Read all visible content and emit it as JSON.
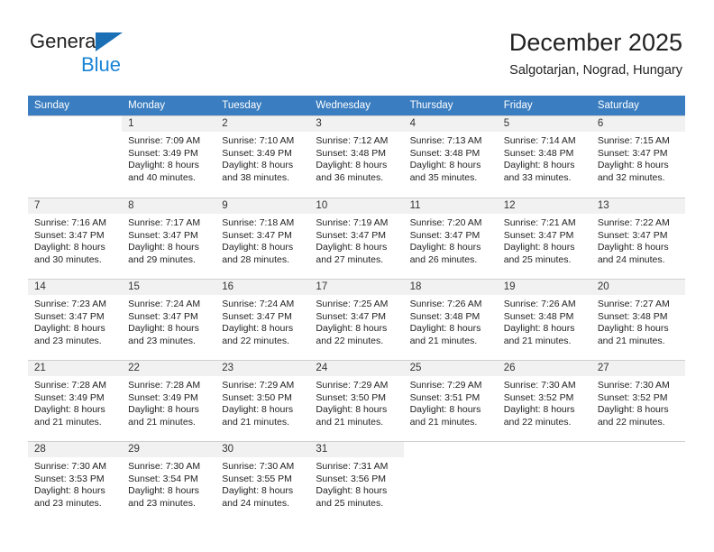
{
  "brand": {
    "name_part1": "General",
    "name_part2": "Blue",
    "triangle_icon": "triangle-icon",
    "colors": {
      "general": "#222222",
      "blue": "#1a84d6",
      "triangle": "#1a6fb5"
    }
  },
  "header": {
    "title": "December 2025",
    "subtitle": "Salgotarjan, Nograd, Hungary"
  },
  "theme": {
    "header_row_bg": "#3a7dc0",
    "header_row_text": "#ffffff",
    "day_number_bg": "#f1f1f1",
    "grid_line": "#cfcfcf"
  },
  "weekdays": [
    "Sunday",
    "Monday",
    "Tuesday",
    "Wednesday",
    "Thursday",
    "Friday",
    "Saturday"
  ],
  "weeks": [
    [
      {
        "day": "",
        "lines": []
      },
      {
        "day": "1",
        "lines": [
          "Sunrise: 7:09 AM",
          "Sunset: 3:49 PM",
          "Daylight: 8 hours",
          "and 40 minutes."
        ]
      },
      {
        "day": "2",
        "lines": [
          "Sunrise: 7:10 AM",
          "Sunset: 3:49 PM",
          "Daylight: 8 hours",
          "and 38 minutes."
        ]
      },
      {
        "day": "3",
        "lines": [
          "Sunrise: 7:12 AM",
          "Sunset: 3:48 PM",
          "Daylight: 8 hours",
          "and 36 minutes."
        ]
      },
      {
        "day": "4",
        "lines": [
          "Sunrise: 7:13 AM",
          "Sunset: 3:48 PM",
          "Daylight: 8 hours",
          "and 35 minutes."
        ]
      },
      {
        "day": "5",
        "lines": [
          "Sunrise: 7:14 AM",
          "Sunset: 3:48 PM",
          "Daylight: 8 hours",
          "and 33 minutes."
        ]
      },
      {
        "day": "6",
        "lines": [
          "Sunrise: 7:15 AM",
          "Sunset: 3:47 PM",
          "Daylight: 8 hours",
          "and 32 minutes."
        ]
      }
    ],
    [
      {
        "day": "7",
        "lines": [
          "Sunrise: 7:16 AM",
          "Sunset: 3:47 PM",
          "Daylight: 8 hours",
          "and 30 minutes."
        ]
      },
      {
        "day": "8",
        "lines": [
          "Sunrise: 7:17 AM",
          "Sunset: 3:47 PM",
          "Daylight: 8 hours",
          "and 29 minutes."
        ]
      },
      {
        "day": "9",
        "lines": [
          "Sunrise: 7:18 AM",
          "Sunset: 3:47 PM",
          "Daylight: 8 hours",
          "and 28 minutes."
        ]
      },
      {
        "day": "10",
        "lines": [
          "Sunrise: 7:19 AM",
          "Sunset: 3:47 PM",
          "Daylight: 8 hours",
          "and 27 minutes."
        ]
      },
      {
        "day": "11",
        "lines": [
          "Sunrise: 7:20 AM",
          "Sunset: 3:47 PM",
          "Daylight: 8 hours",
          "and 26 minutes."
        ]
      },
      {
        "day": "12",
        "lines": [
          "Sunrise: 7:21 AM",
          "Sunset: 3:47 PM",
          "Daylight: 8 hours",
          "and 25 minutes."
        ]
      },
      {
        "day": "13",
        "lines": [
          "Sunrise: 7:22 AM",
          "Sunset: 3:47 PM",
          "Daylight: 8 hours",
          "and 24 minutes."
        ]
      }
    ],
    [
      {
        "day": "14",
        "lines": [
          "Sunrise: 7:23 AM",
          "Sunset: 3:47 PM",
          "Daylight: 8 hours",
          "and 23 minutes."
        ]
      },
      {
        "day": "15",
        "lines": [
          "Sunrise: 7:24 AM",
          "Sunset: 3:47 PM",
          "Daylight: 8 hours",
          "and 23 minutes."
        ]
      },
      {
        "day": "16",
        "lines": [
          "Sunrise: 7:24 AM",
          "Sunset: 3:47 PM",
          "Daylight: 8 hours",
          "and 22 minutes."
        ]
      },
      {
        "day": "17",
        "lines": [
          "Sunrise: 7:25 AM",
          "Sunset: 3:47 PM",
          "Daylight: 8 hours",
          "and 22 minutes."
        ]
      },
      {
        "day": "18",
        "lines": [
          "Sunrise: 7:26 AM",
          "Sunset: 3:48 PM",
          "Daylight: 8 hours",
          "and 21 minutes."
        ]
      },
      {
        "day": "19",
        "lines": [
          "Sunrise: 7:26 AM",
          "Sunset: 3:48 PM",
          "Daylight: 8 hours",
          "and 21 minutes."
        ]
      },
      {
        "day": "20",
        "lines": [
          "Sunrise: 7:27 AM",
          "Sunset: 3:48 PM",
          "Daylight: 8 hours",
          "and 21 minutes."
        ]
      }
    ],
    [
      {
        "day": "21",
        "lines": [
          "Sunrise: 7:28 AM",
          "Sunset: 3:49 PM",
          "Daylight: 8 hours",
          "and 21 minutes."
        ]
      },
      {
        "day": "22",
        "lines": [
          "Sunrise: 7:28 AM",
          "Sunset: 3:49 PM",
          "Daylight: 8 hours",
          "and 21 minutes."
        ]
      },
      {
        "day": "23",
        "lines": [
          "Sunrise: 7:29 AM",
          "Sunset: 3:50 PM",
          "Daylight: 8 hours",
          "and 21 minutes."
        ]
      },
      {
        "day": "24",
        "lines": [
          "Sunrise: 7:29 AM",
          "Sunset: 3:50 PM",
          "Daylight: 8 hours",
          "and 21 minutes."
        ]
      },
      {
        "day": "25",
        "lines": [
          "Sunrise: 7:29 AM",
          "Sunset: 3:51 PM",
          "Daylight: 8 hours",
          "and 21 minutes."
        ]
      },
      {
        "day": "26",
        "lines": [
          "Sunrise: 7:30 AM",
          "Sunset: 3:52 PM",
          "Daylight: 8 hours",
          "and 22 minutes."
        ]
      },
      {
        "day": "27",
        "lines": [
          "Sunrise: 7:30 AM",
          "Sunset: 3:52 PM",
          "Daylight: 8 hours",
          "and 22 minutes."
        ]
      }
    ],
    [
      {
        "day": "28",
        "lines": [
          "Sunrise: 7:30 AM",
          "Sunset: 3:53 PM",
          "Daylight: 8 hours",
          "and 23 minutes."
        ]
      },
      {
        "day": "29",
        "lines": [
          "Sunrise: 7:30 AM",
          "Sunset: 3:54 PM",
          "Daylight: 8 hours",
          "and 23 minutes."
        ]
      },
      {
        "day": "30",
        "lines": [
          "Sunrise: 7:30 AM",
          "Sunset: 3:55 PM",
          "Daylight: 8 hours",
          "and 24 minutes."
        ]
      },
      {
        "day": "31",
        "lines": [
          "Sunrise: 7:31 AM",
          "Sunset: 3:56 PM",
          "Daylight: 8 hours",
          "and 25 minutes."
        ]
      },
      {
        "day": "",
        "lines": []
      },
      {
        "day": "",
        "lines": []
      },
      {
        "day": "",
        "lines": []
      }
    ]
  ]
}
